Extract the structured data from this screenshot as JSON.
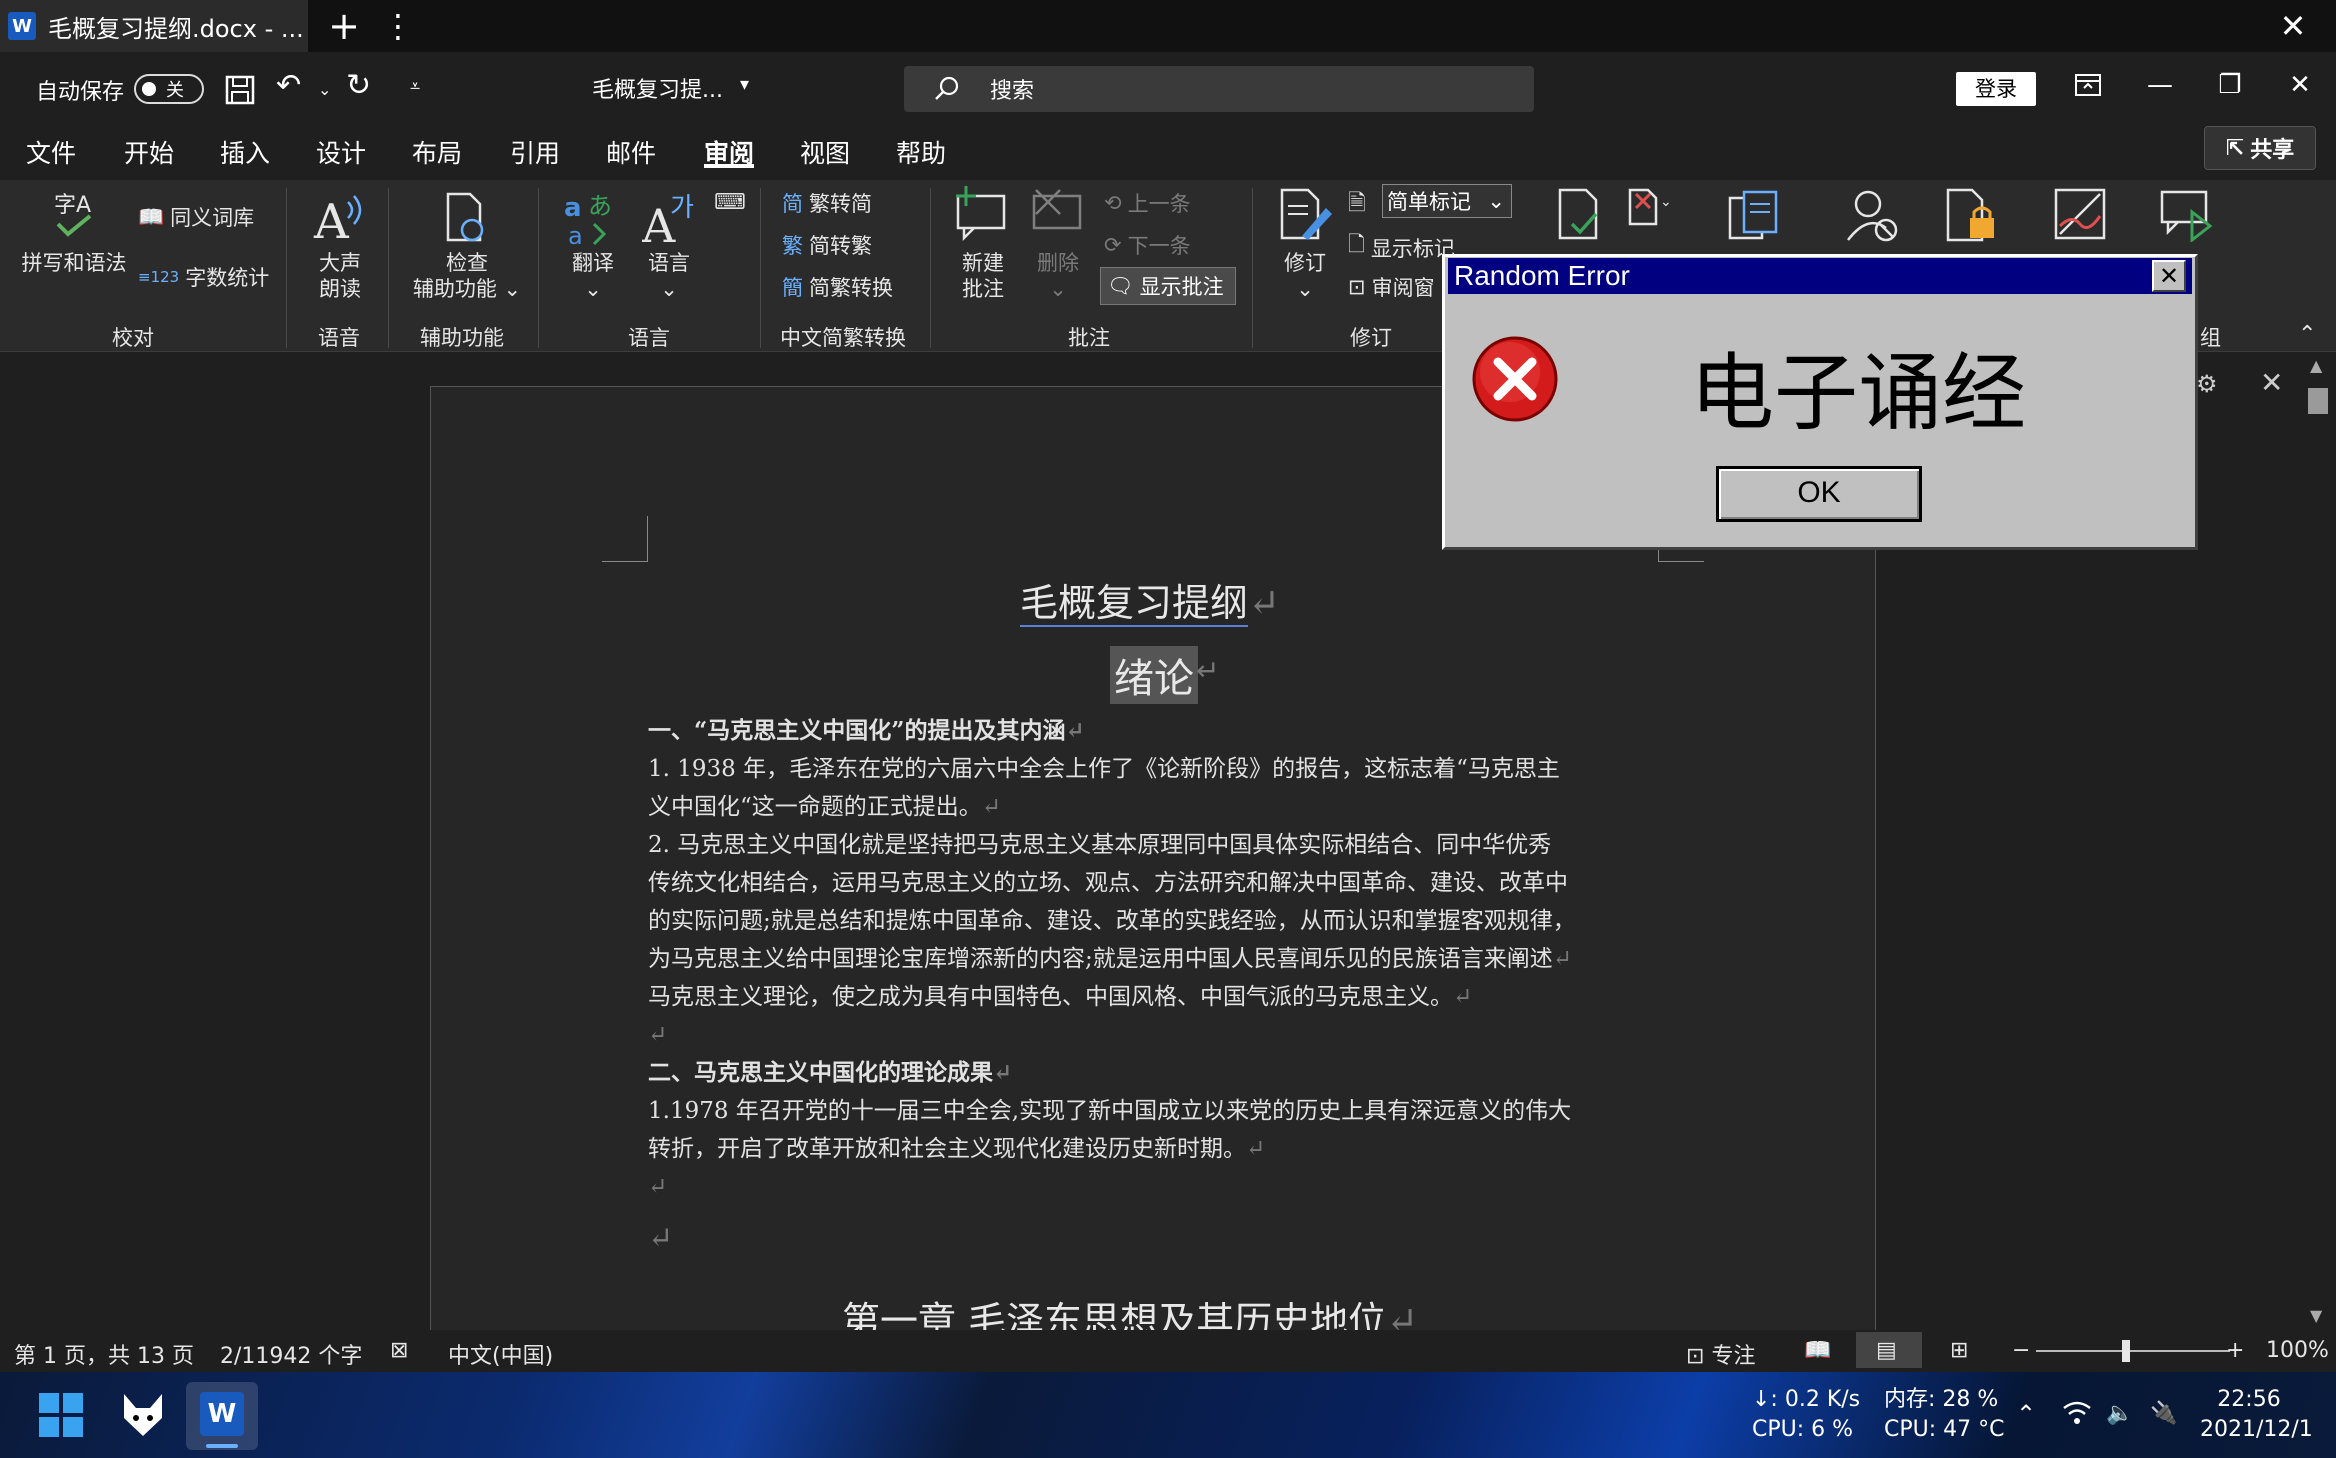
{
  "tabstrip": {
    "tab_title": "毛概复习提纲.docx - ...",
    "new_tab": "+",
    "more": "⋮",
    "close": "✕"
  },
  "titlebar": {
    "autosave_label": "自动保存",
    "autosave_state": "关",
    "doc_title": "毛概复习提...",
    "search_placeholder": "搜索",
    "login": "登录"
  },
  "menu": {
    "tabs": [
      "文件",
      "开始",
      "插入",
      "设计",
      "布局",
      "引用",
      "邮件",
      "审阅",
      "视图",
      "帮助"
    ],
    "active": "审阅",
    "share": "共享"
  },
  "ribbon": {
    "spelling": "拼写和语法",
    "thesaurus": "同义词库",
    "wordcount": "字数统计",
    "read_aloud_1": "大声",
    "read_aloud_2": "朗读",
    "check_access_1": "检查",
    "check_access_2": "辅助功能",
    "translate": "翻译",
    "language": "语言",
    "trad_to_simp": "繁转简",
    "simp_to_trad": "简转繁",
    "simp_trad_convert": "简繁转换",
    "new_comment_1": "新建",
    "new_comment_2": "批注",
    "delete": "删除",
    "prev": "上一条",
    "next": "下一条",
    "show_comments": "显示批注",
    "track": "修订",
    "markup": "简单标记",
    "show_markup": "显示标记",
    "review_pane": "审阅窗",
    "groups": {
      "proofing": "校对",
      "speech": "语音",
      "accessibility": "辅助功能",
      "language": "语言",
      "chinese_conversion": "中文简繁转换",
      "comments": "批注",
      "tracking": "修订",
      "partial_group": "组"
    }
  },
  "document": {
    "title": "毛概复习提纲",
    "subtitle": "绪论",
    "h1": "一、“马克思主义中国化”的提出及其内涵",
    "p1_line1": "1. 1938 年，毛泽东在党的六届六中全会上作了《论新阶段》的报告，这标志着“马克思主",
    "p1_line2": "义中国化“这一命题的正式提出。",
    "p2_line1": "2.  马克思主义中国化就是坚持把马克思主义基本原理同中国具体实际相结合、同中华优秀",
    "p2_line2": "传统文化相结合，运用马克思主义的立场、观点、方法研究和解决中国革命、建设、改革中",
    "p2_line3": "的实际问题;就是总结和提炼中国革命、建设、改革的实践经验，从而认识和掌握客观规律，",
    "p2_line4": "为马克思主义给中国理论宝库增添新的内容;就是运用中国人民喜闻乐见的民族语言来阐述",
    "p2_line5": "马克思主义理论，使之成为具有中国特色、中国风格、中国气派的马克思主义。",
    "h2": "二、马克思主义中国化的理论成果",
    "p3_line1": "1.1978 年召开党的十一届三中全会,实现了新中国成立以来党的历史上具有深远意义的伟大",
    "p3_line2": "转折，开启了改革开放和社会主义现代化建设历史新时期。",
    "chapter": "第一章 毛泽东思想及其历史地位"
  },
  "statusbar": {
    "page": "第 1 页，共 13 页",
    "words": "2/11942 个字",
    "lang": "中文(中国)",
    "focus": "专注",
    "zoom": "100%"
  },
  "taskbar": {
    "net": "↓: 0.2 K/s",
    "cpu": "CPU: 6 %",
    "mem": "内存: 28 %",
    "cpu_temp": "CPU: 47 °C",
    "time": "22:56",
    "date": "2021/12/1"
  },
  "dialog": {
    "title": "Random Error",
    "message": "电子诵经",
    "ok": "OK",
    "close": "✕"
  },
  "colors": {
    "dialog_title_bg": "#000080",
    "dialog_bg": "#c0c0c0",
    "word_blue": "#185abd",
    "ribbon_bg": "#2b2b2b"
  }
}
